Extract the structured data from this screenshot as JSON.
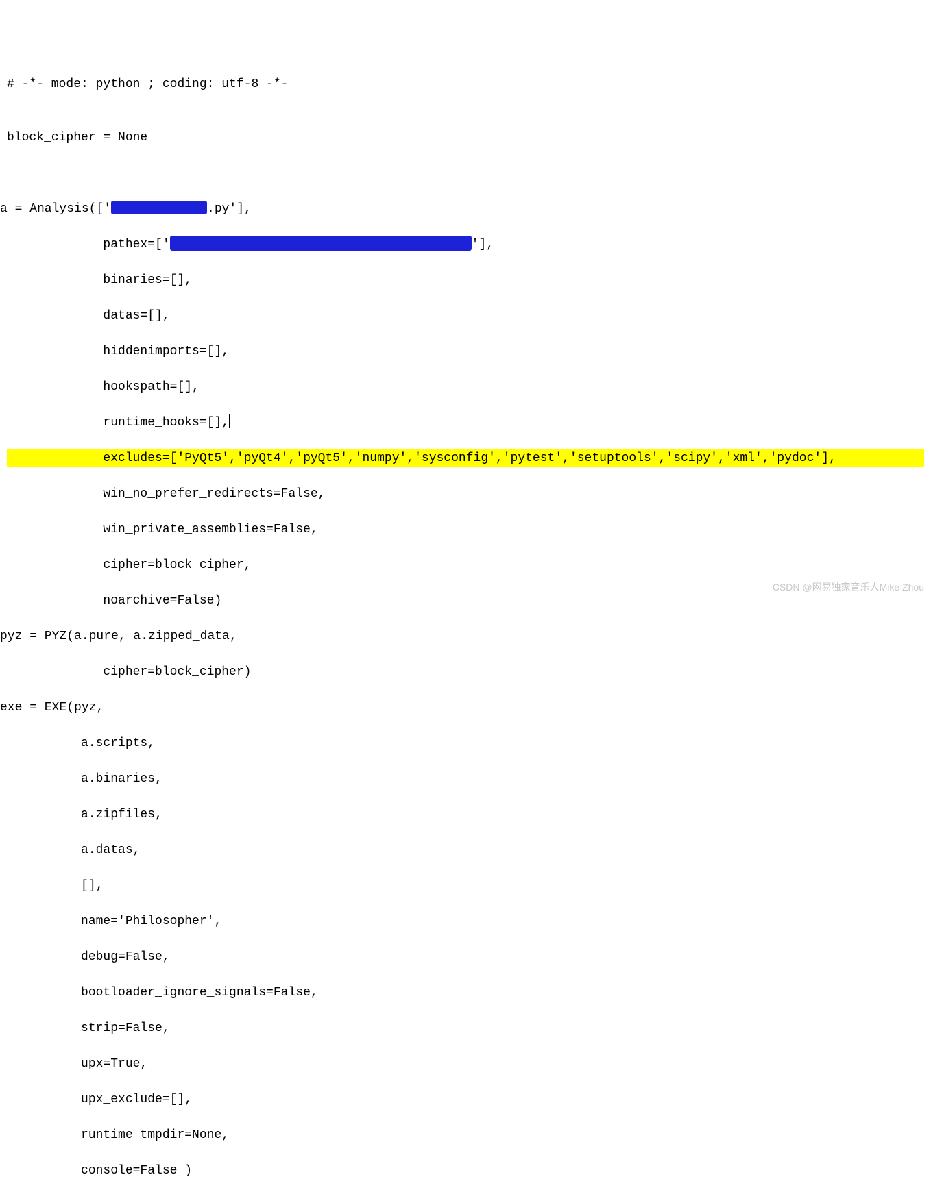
{
  "code": {
    "l1": "# -*- mode: python ; coding: utf-8 -*-",
    "l2": "",
    "l3": "block_cipher = None",
    "l4": "",
    "l5": "",
    "l6_a": "a = Analysis(['",
    "l6_b": ".py'],",
    "l7_a": "             pathex=['",
    "l7_b": "'],",
    "l8": "             binaries=[],",
    "l9": "             datas=[],",
    "l10": "             hiddenimports=[],",
    "l11": "             hookspath=[],",
    "l12": "             runtime_hooks=[],",
    "l13": "             excludes=['PyQt5','pyQt4','pyQt5','numpy','sysconfig','pytest','setuptools','scipy','xml','pydoc'],",
    "l14": "             win_no_prefer_redirects=False,",
    "l15": "             win_private_assemblies=False,",
    "l16": "             cipher=block_cipher,",
    "l17": "             noarchive=False)",
    "l18": "pyz = PYZ(a.pure, a.zipped_data,",
    "l19": "             cipher=block_cipher)",
    "l20": "exe = EXE(pyz,",
    "l21": "          a.scripts,",
    "l22": "          a.binaries,",
    "l23": "          a.zipfiles,",
    "l24": "          a.datas,",
    "l25": "          [],",
    "l26": "          name='Philosopher',",
    "l27": "          debug=False,",
    "l28": "          bootloader_ignore_signals=False,",
    "l29": "          strip=False,",
    "l30": "          upx=True,",
    "l31": "          upx_exclude=[],",
    "l32": "          runtime_tmpdir=None,",
    "l33": "          console=False )"
  },
  "watermark": "CSDN @网易独家音乐人Mike Zhou"
}
